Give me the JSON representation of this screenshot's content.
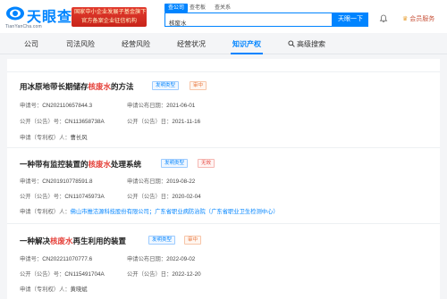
{
  "header": {
    "logo_text": "天眼查",
    "logo_url": "TianYanCha.com",
    "promo_line1": "国家中小企业发展子基金旗下",
    "promo_line2": "官方备案企业征信机构",
    "search_tabs": [
      "查公司",
      "查老板",
      "查关系"
    ],
    "search_value": "核废水",
    "search_button": "天眼一下",
    "member_label": "会员服务"
  },
  "nav": {
    "items": [
      "公司",
      "司法风险",
      "经营风险",
      "经营状况",
      "知识产权",
      "高级搜索"
    ],
    "active": "知识产权"
  },
  "patents": [
    {
      "title_pre": "用冰原地带长期储存",
      "title_hl": "核废水",
      "title_post": "的方法",
      "type_tag": "发明类型",
      "status_tag": "审中",
      "app_no_label": "申请号：",
      "app_no": "CN202110657844.3",
      "app_date_label": "申请公布日期：",
      "app_date": "2021-06-01",
      "pub_no_label": "公开（公告）号：",
      "pub_no": "CN113658738A",
      "pub_date_label": "公开（公告）日：",
      "pub_date": "2021-11-16",
      "applicant_label": "申请（专利权）人：",
      "applicants": [
        "曹长风"
      ]
    },
    {
      "title_pre": "一种带有监控装置的",
      "title_hl": "核废水",
      "title_post": "处理系统",
      "type_tag": "发明类型",
      "status_tag": "无效",
      "app_no_label": "申请号：",
      "app_no": "CN201910778591.8",
      "app_date_label": "申请公布日期：",
      "app_date": "2019-08-22",
      "pub_no_label": "公开（公告）号：",
      "pub_no": "CN110745973A",
      "pub_date_label": "公开（公告）日：",
      "pub_date": "2020-02-04",
      "applicant_label": "申请（专利权）人：",
      "applicants": [
        "佛山市推洁源科技股份有限公司；",
        "广东省职业病防治院（广东省职业卫生检测中心）"
      ]
    },
    {
      "title_pre": "一种解决",
      "title_hl": "核废水",
      "title_post": "再生利用的装置",
      "type_tag": "发明类型",
      "status_tag": "审中",
      "app_no_label": "申请号：",
      "app_no": "CN202211070777.6",
      "app_date_label": "申请公布日期：",
      "app_date": "2022-09-02",
      "pub_no_label": "公开（公告）号：",
      "pub_no": "CN115491704A",
      "pub_date_label": "公开（公告）日：",
      "pub_date": "2022-12-20",
      "applicant_label": "申请（专利权）人：",
      "applicants": [
        "黄晓斌"
      ]
    }
  ],
  "colors": {
    "brand": "#0084ff",
    "highlight": "#e5423b",
    "member": "#c8553d"
  },
  "icons": [
    "logo-mark-icon",
    "search-icon",
    "bell-icon",
    "crown-icon"
  ]
}
